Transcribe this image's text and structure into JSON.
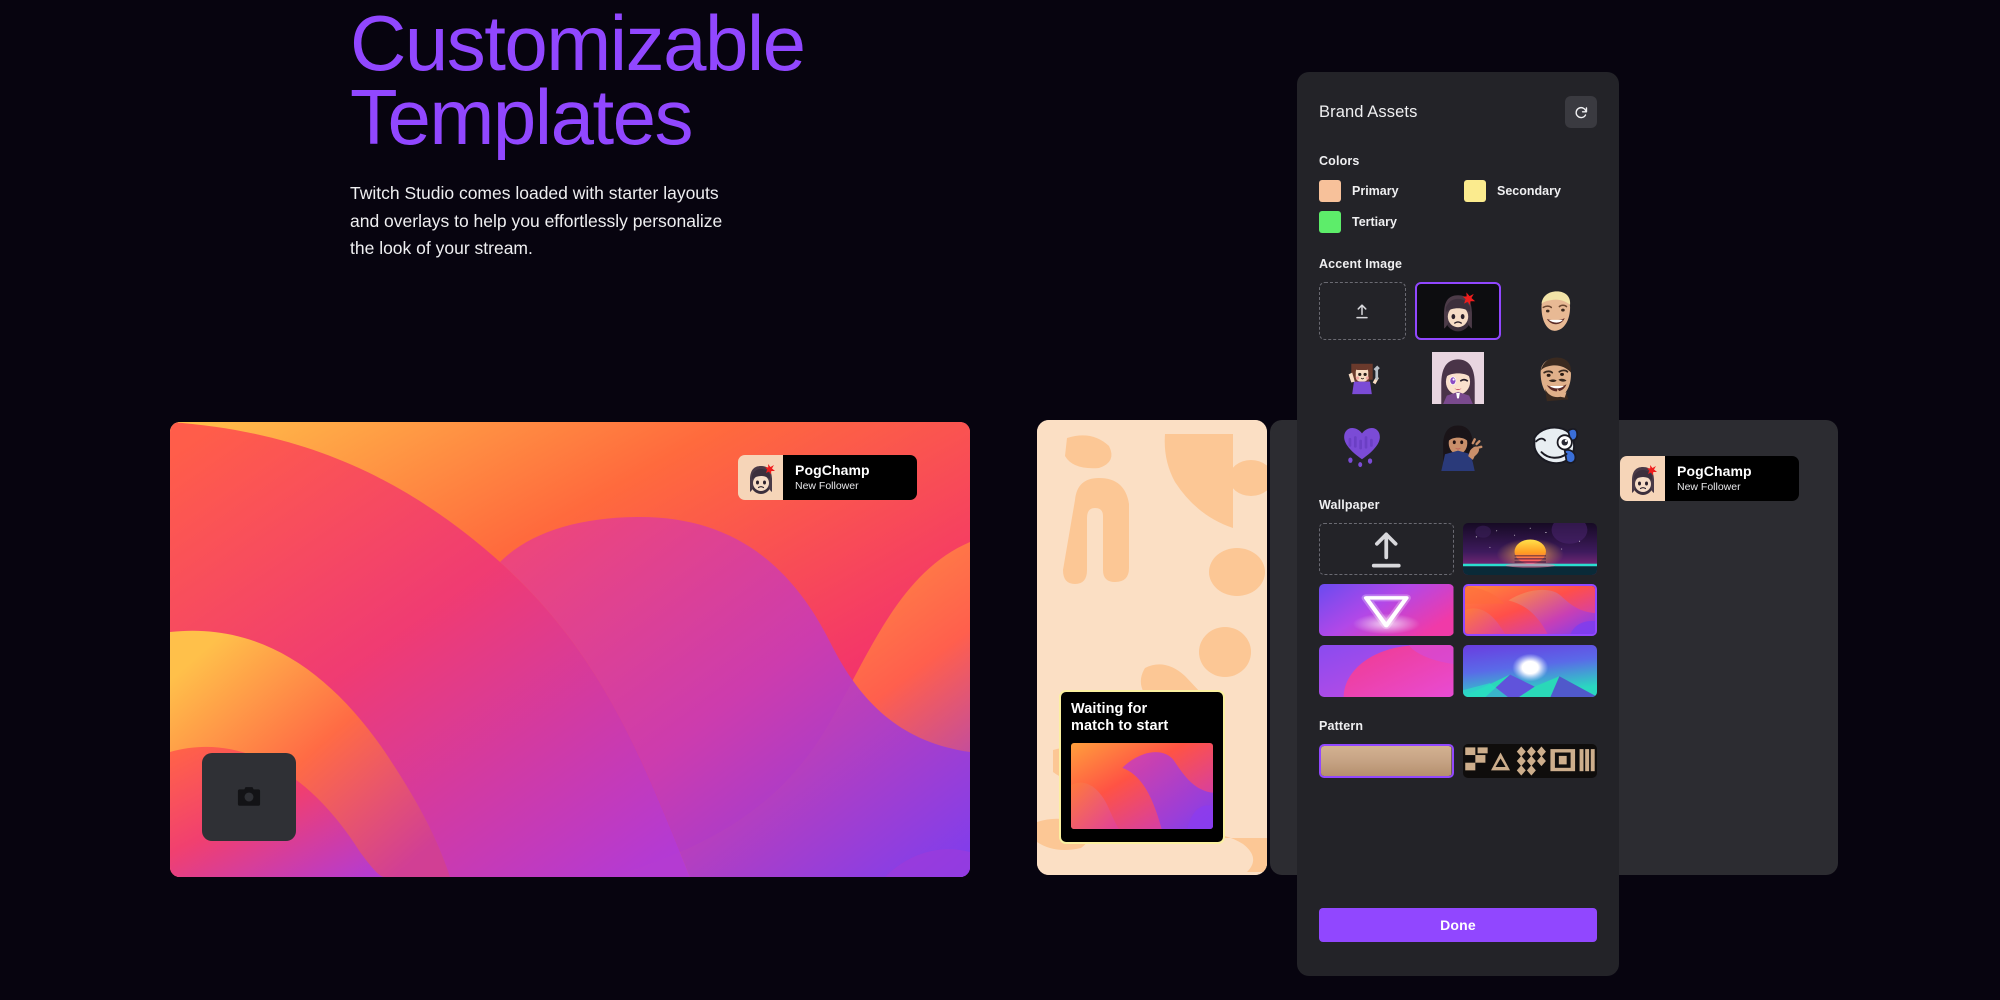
{
  "hero": {
    "title": "Customizable\nTemplates",
    "subtitle": "Twitch Studio comes loaded with starter layouts and overlays to help you effortlessly personalize the look of your stream.",
    "title_color": "#9147ff"
  },
  "stream_preview": {
    "camera_icon": "camera-icon",
    "wallpaper_name": "orange-purple-waves"
  },
  "alerts": [
    {
      "name": "PogChamp",
      "subtitle": "New Follower",
      "avatar_icon": "anime-angry-emote"
    },
    {
      "name": "PogChamp",
      "subtitle": "New Follower",
      "avatar_icon": "anime-angry-emote"
    }
  ],
  "waiting_card": {
    "title": "Waiting for\nmatch to start",
    "border_color": "#fbf0a0"
  },
  "brand_assets": {
    "title": "Brand Assets",
    "refresh_icon": "refresh-icon",
    "colors": {
      "label": "Colors",
      "items": [
        {
          "name": "Primary",
          "hex": "#f7c19a"
        },
        {
          "name": "Secondary",
          "hex": "#fbeb8e"
        },
        {
          "name": "Tertiary",
          "hex": "#5ded6a"
        }
      ]
    },
    "accent_image": {
      "label": "Accent Image",
      "upload_icon": "upload-icon",
      "items": [
        {
          "icon": "upload-slot",
          "selected": false,
          "type": "upload"
        },
        {
          "icon": "anime-angry-emote",
          "selected": true,
          "type": "emote"
        },
        {
          "icon": "blonde-man-emote",
          "selected": false,
          "type": "emote"
        },
        {
          "icon": "pixel-girl-emote",
          "selected": false,
          "type": "emote"
        },
        {
          "icon": "anime-wink-emote",
          "selected": false,
          "type": "emote"
        },
        {
          "icon": "bearded-man-emote",
          "selected": false,
          "type": "emote"
        },
        {
          "icon": "purple-drip-heart-emote",
          "selected": false,
          "type": "emote"
        },
        {
          "icon": "waving-woman-emote",
          "selected": false,
          "type": "emote"
        },
        {
          "icon": "fish-emote",
          "selected": false,
          "type": "emote"
        }
      ]
    },
    "wallpaper": {
      "label": "Wallpaper",
      "upload_icon": "upload-icon",
      "items": [
        {
          "icon": "upload-slot",
          "selected": false,
          "type": "upload"
        },
        {
          "icon": "retro-sunset",
          "selected": false,
          "type": "wallpaper"
        },
        {
          "icon": "neon-triangle",
          "selected": false,
          "type": "wallpaper"
        },
        {
          "icon": "orange-purple-waves",
          "selected": true,
          "type": "wallpaper"
        },
        {
          "icon": "pink-purple-blob",
          "selected": false,
          "type": "wallpaper"
        },
        {
          "icon": "teal-moon-mountain",
          "selected": false,
          "type": "wallpaper"
        }
      ]
    },
    "pattern": {
      "label": "Pattern",
      "items": [
        {
          "icon": "solid-tan-pattern",
          "selected": true
        },
        {
          "icon": "geometric-pattern",
          "selected": false
        }
      ]
    },
    "done_label": "Done",
    "accent_color": "#9147ff"
  }
}
